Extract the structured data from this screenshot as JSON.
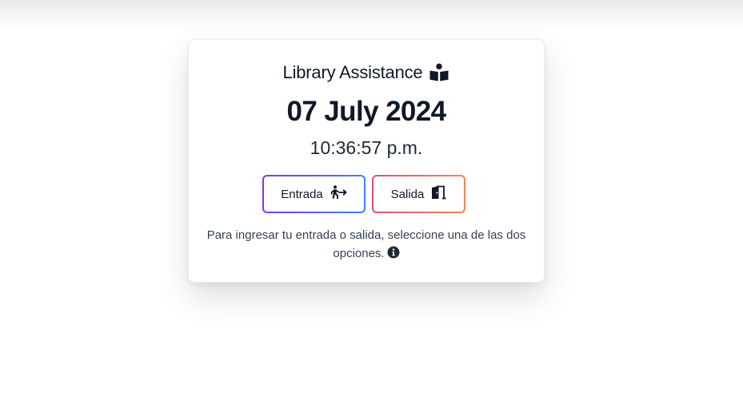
{
  "card": {
    "title": "Library Assistance",
    "title_icon": "book-reader-icon",
    "date": "07 July 2024",
    "time": "10:36:57 p.m.",
    "buttons": {
      "entrada_label": "Entrada",
      "entrada_icon": "person-walking-arrow-right-icon",
      "salida_label": "Salida",
      "salida_icon": "door-exit-icon"
    },
    "help_text": "Para ingresar tu entrada o salida, seleccione una de las dos opciones.",
    "help_icon": "info-circle-icon"
  },
  "colors": {
    "entrada_border_start": "#7c3aed",
    "entrada_border_end": "#3b82f6",
    "salida_border_start": "#e0507a",
    "salida_border_end": "#f0885a"
  }
}
